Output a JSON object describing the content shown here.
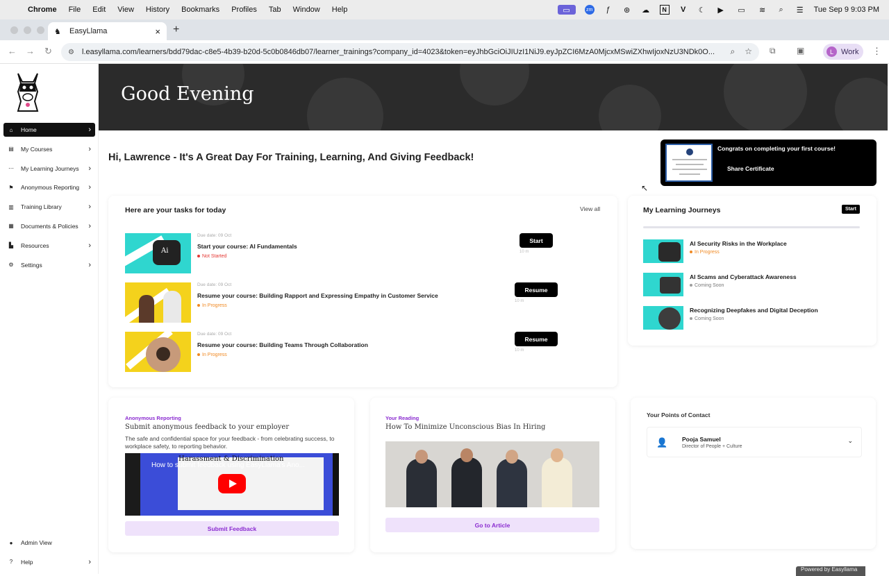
{
  "menubar": {
    "app": "Chrome",
    "items": [
      "File",
      "Edit",
      "View",
      "History",
      "Bookmarks",
      "Profiles",
      "Tab",
      "Window",
      "Help"
    ],
    "datetime": "Tue Sep 9  9:03 PM"
  },
  "browser": {
    "tab_title": "EasyLlama",
    "url": "l.easyllama.com/learners/bdd79dac-c8e5-4b39-b20d-5c0b0846db07/learner_trainings?company_id=4023&token=eyJhbGciOiJIUzI1NiJ9.eyJpZCI6MzA0MjcxMSwiZXhwIjoxNzU3NDk0O...",
    "profile_initial": "L",
    "profile_label": "Work"
  },
  "sidebar": {
    "items": [
      {
        "label": "Home",
        "icon": "home-icon"
      },
      {
        "label": "My Courses",
        "icon": "book-icon"
      },
      {
        "label": "My Learning Journeys",
        "icon": "journey-icon"
      },
      {
        "label": "Anonymous Reporting",
        "icon": "flag-icon"
      },
      {
        "label": "Training Library",
        "icon": "library-icon"
      },
      {
        "label": "Documents & Policies",
        "icon": "document-icon"
      },
      {
        "label": "Resources",
        "icon": "resources-icon"
      },
      {
        "label": "Settings",
        "icon": "gear-icon"
      }
    ],
    "admin_view": "Admin View",
    "help": "Help"
  },
  "hero": {
    "title": "Good Evening"
  },
  "greeting": "Hi, Lawrence - It's A Great Day For Training, Learning, And Giving Feedback!",
  "certificate": {
    "message": "Congrats on completing your first course!",
    "action": "Share Certificate"
  },
  "tasks": {
    "title": "Here are your tasks for today",
    "view_all": "View all",
    "items": [
      {
        "due": "Due date: 09 Oct",
        "name": "Start your course: AI Fundamentals",
        "status": "Not Started",
        "button": "Start",
        "duration": "10 m"
      },
      {
        "due": "Due date: 09 Oct",
        "name": "Resume your course: Building Rapport and Expressing Empathy in Customer Service",
        "status": "In Progress",
        "button": "Resume",
        "duration": "10 m"
      },
      {
        "due": "Due date: 09 Oct",
        "name": "Resume your course: Building Teams Through Collaboration",
        "status": "In Progress",
        "button": "Resume",
        "duration": "10 m"
      }
    ]
  },
  "journeys": {
    "title": "My Learning Journeys",
    "start": "Start",
    "items": [
      {
        "name": "AI Security Risks in the Workplace",
        "status": "In Progress"
      },
      {
        "name": "AI Scams and Cyberattack Awareness",
        "status": "Coming Soon"
      },
      {
        "name": "Recognizing Deepfakes and Digital Deception",
        "status": "Coming Soon"
      }
    ]
  },
  "reporting": {
    "label": "Anonymous Reporting",
    "heading": "Submit anonymous feedback to your employer",
    "description": "The safe and confidential space for your feedback - from celebrating success, to workplace safety, to reporting behavior.",
    "video_title": "How to submit feedback using EasyLlama's Ano...",
    "video_heading": "Harassment & Discrimination",
    "button": "Submit Feedback"
  },
  "reading": {
    "label": "Your Reading",
    "heading": "How To Minimize Unconscious Bias In Hiring",
    "button": "Go to Article"
  },
  "contact": {
    "title": "Your Points of Contact",
    "name": "Pooja Samuel",
    "role": "Director of People + Culture"
  },
  "footer": {
    "powered": "Powered by Easyllama"
  },
  "colors": {
    "accent_purple": "#8a2bd0",
    "not_started": "#e53935",
    "in_progress": "#f08a24",
    "coming_soon": "#9e9e9e",
    "hero_bg": "#2b2b2b",
    "teal": "#2fd6cf",
    "yellow": "#f4d21c"
  }
}
